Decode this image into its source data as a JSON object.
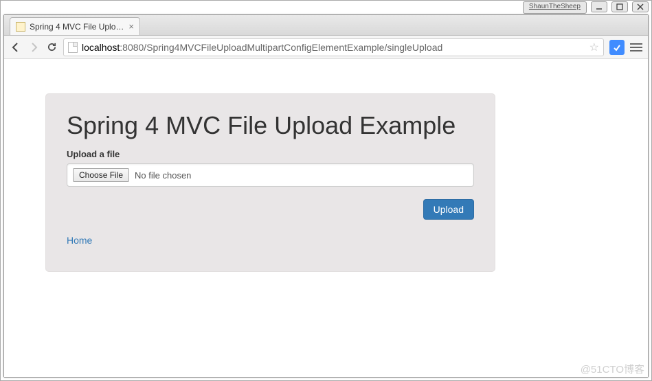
{
  "titlebar": {
    "user": "ShaunTheSheep"
  },
  "tab": {
    "title": "Spring 4 MVC File Upload"
  },
  "address": {
    "host": "localhost",
    "port_path": ":8080/Spring4MVCFileUploadMultipartConfigElementExample/singleUpload"
  },
  "page": {
    "heading": "Spring 4 MVC File Upload Example",
    "upload_label": "Upload a file",
    "choose_label": "Choose File",
    "no_file_text": "No file chosen",
    "submit_label": "Upload",
    "home_link": "Home"
  },
  "watermark": "@51CTO博客"
}
